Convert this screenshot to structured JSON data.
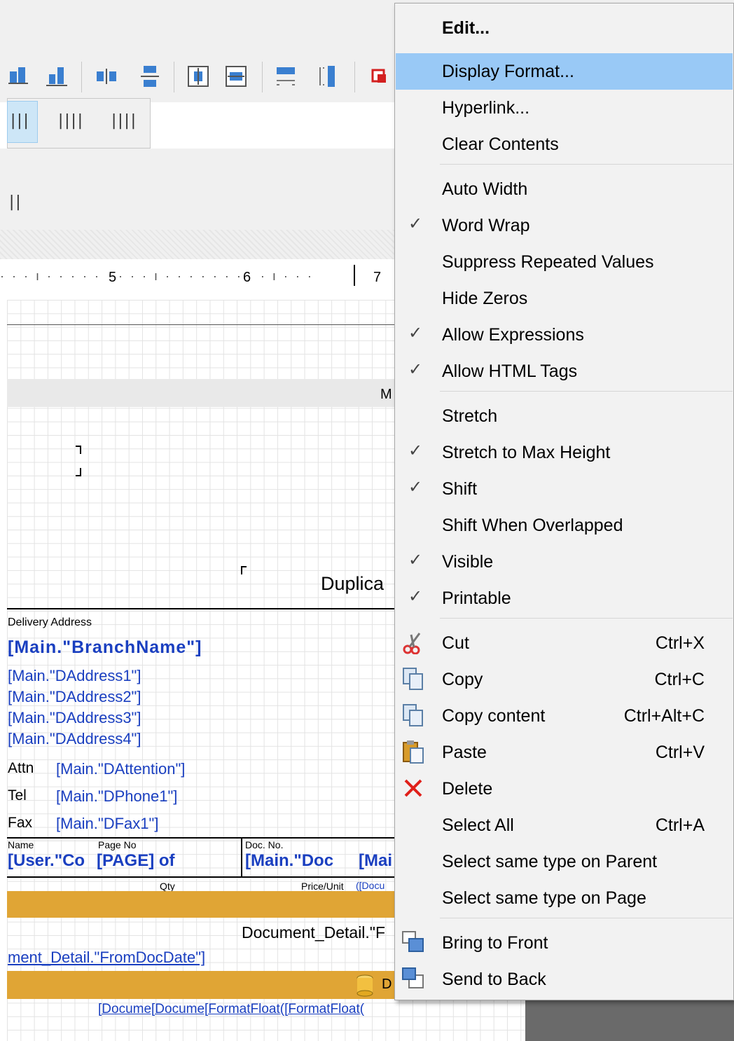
{
  "ruler": {
    "n5": "5",
    "n6": "6",
    "n7": "7"
  },
  "designer": {
    "band_label": "M",
    "duplicate_text": "Duplica",
    "delivery_address_label": "Delivery Address",
    "branch_name": "[Main.\"BranchName\"]",
    "addresses": [
      "[Main.\"DAddress1\"]",
      "[Main.\"DAddress2\"]",
      "[Main.\"DAddress3\"]",
      "[Main.\"DAddress4\"]"
    ],
    "attn_label": "Attn",
    "attn_value": "[Main.\"DAttention\"]",
    "tel_label": "Tel",
    "tel_value": "[Main.\"DPhone1\"]",
    "fax_label": "Fax",
    "fax_value": "[Main.\"DFax1\"]",
    "name_label": "Name",
    "page_no_label": "Page No",
    "doc_no_label": "Doc. No.",
    "user_field": "[User.\"Co",
    "page_field": "[PAGE] of",
    "doc_field": "[Main.\"Doc",
    "mai_field": "[Mai",
    "qty_label": "Qty",
    "price_unit_label": "Price/Unit",
    "docu_label": "([Docu",
    "detail_header": "Document_Detail.\"F",
    "from_doc_date": "ment_Detail.\"FromDocDate\"]",
    "detail_band_letter": "D",
    "bottom_fields": "[Docume[Docume[FormatFloat([FormatFloat("
  },
  "context_menu": {
    "items": [
      {
        "label": "Edit...",
        "bold": true
      },
      {
        "label": "Display Format...",
        "highlighted": true
      },
      {
        "label": "Hyperlink..."
      },
      {
        "label": "Clear Contents"
      },
      {
        "label": "Auto Width"
      },
      {
        "label": "Word Wrap",
        "checked": true
      },
      {
        "label": "Suppress Repeated Values"
      },
      {
        "label": "Hide Zeros"
      },
      {
        "label": "Allow Expressions",
        "checked": true
      },
      {
        "label": "Allow HTML Tags",
        "checked": true
      },
      {
        "label": "Stretch"
      },
      {
        "label": "Stretch to Max Height",
        "checked": true
      },
      {
        "label": "Shift",
        "checked": true
      },
      {
        "label": "Shift When Overlapped"
      },
      {
        "label": "Visible",
        "checked": true
      },
      {
        "label": "Printable",
        "checked": true
      },
      {
        "label": "Cut",
        "shortcut": "Ctrl+X",
        "icon": "scissors-icon"
      },
      {
        "label": "Copy",
        "shortcut": "Ctrl+C",
        "icon": "copy-icon"
      },
      {
        "label": "Copy content",
        "shortcut": "Ctrl+Alt+C",
        "icon": "copy-content-icon"
      },
      {
        "label": "Paste",
        "shortcut": "Ctrl+V",
        "icon": "paste-icon"
      },
      {
        "label": "Delete",
        "icon": "delete-icon"
      },
      {
        "label": "Select All",
        "shortcut": "Ctrl+A"
      },
      {
        "label": "Select same type on Parent"
      },
      {
        "label": "Select same type on Page"
      },
      {
        "label": "Bring to Front",
        "icon": "bring-to-front-icon"
      },
      {
        "label": "Send to Back",
        "icon": "send-to-back-icon"
      }
    ],
    "check_glyph": "✓"
  }
}
